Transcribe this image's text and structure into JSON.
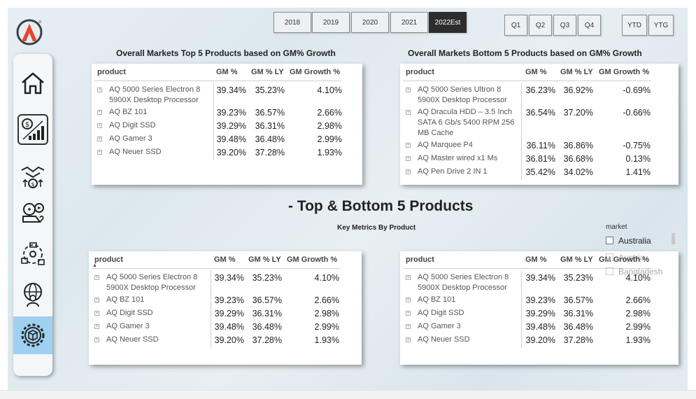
{
  "nav": {
    "items": [
      {
        "icon": "home-icon"
      },
      {
        "icon": "finance-chart-icon"
      },
      {
        "icon": "handshake-money-icon"
      },
      {
        "icon": "marketing-icon"
      },
      {
        "icon": "supply-chain-icon"
      },
      {
        "icon": "global-team-icon"
      },
      {
        "icon": "product-settings-icon"
      }
    ],
    "active_index": 6
  },
  "years": [
    "2018",
    "2019",
    "2020",
    "2021",
    "2022Est"
  ],
  "selected_year": "2022Est",
  "quarters": [
    "Q1",
    "Q2",
    "Q3",
    "Q4"
  ],
  "period_buttons": [
    "YTD",
    "YTG"
  ],
  "top_table": {
    "title": "Overall Markets Top 5 Products based on GM% Growth",
    "headers": {
      "product": "product",
      "gm": "GM %",
      "gm_ly": "GM % LY",
      "growth": "GM Growth %"
    },
    "rows": [
      {
        "product": [
          "AQ 5000 Series Electron 8",
          "5900X Desktop Processor"
        ],
        "gm": "39.34%",
        "gm_ly": "35.23%",
        "growth": "4.10%"
      },
      {
        "product": [
          "AQ BZ 101"
        ],
        "gm": "39.23%",
        "gm_ly": "36.57%",
        "growth": "2.66%"
      },
      {
        "product": [
          "AQ Digit SSD"
        ],
        "gm": "39.29%",
        "gm_ly": "36.31%",
        "growth": "2.98%"
      },
      {
        "product": [
          "AQ Gamer 3"
        ],
        "gm": "39.48%",
        "gm_ly": "36.48%",
        "growth": "2.99%"
      },
      {
        "product": [
          "AQ Neuer SSD"
        ],
        "gm": "39.20%",
        "gm_ly": "37.28%",
        "growth": "1.93%"
      }
    ]
  },
  "bottom_table": {
    "title": "Overall Markets Bottom 5 Products based on GM% Growth",
    "headers": {
      "product": "product",
      "gm": "GM %",
      "gm_ly": "GM % LY",
      "growth": "GM Growth %"
    },
    "rows": [
      {
        "product": [
          "AQ 5000 Series Ultron 8",
          "5900X Desktop Processor"
        ],
        "gm": "36.23%",
        "gm_ly": "36.92%",
        "growth": "-0.69%"
      },
      {
        "product": [
          "AQ Dracula HDD – 3.5 Inch",
          "SATA 6 Gb/s 5400 RPM 256",
          "MB Cache"
        ],
        "gm": "36.54%",
        "gm_ly": "37.20%",
        "growth": "-0.66%"
      },
      {
        "product": [
          "AQ Marquee P4"
        ],
        "gm": "36.11%",
        "gm_ly": "36.86%",
        "growth": "-0.75%"
      },
      {
        "product": [
          "AQ Master wired x1 Ms"
        ],
        "gm": "36.81%",
        "gm_ly": "36.68%",
        "growth": "0.13%"
      },
      {
        "product": [
          "AQ Pen Drive 2 IN 1"
        ],
        "gm": "35.42%",
        "gm_ly": "34.02%",
        "growth": "1.41%"
      }
    ]
  },
  "main_title": "- Top & Bottom 5 Products",
  "sub_title": "Key Metrics By Product",
  "lower_left": {
    "headers": {
      "product": "product",
      "gm": "GM %",
      "gm_ly": "GM % LY",
      "growth": "GM Growth %"
    },
    "rows": [
      {
        "product": [
          "AQ 5000 Series Electron 8",
          "5900X Desktop Processor"
        ],
        "gm": "39.34%",
        "gm_ly": "35.23%",
        "growth": "4.10%"
      },
      {
        "product": [
          "AQ BZ 101"
        ],
        "gm": "39.23%",
        "gm_ly": "36.57%",
        "growth": "2.66%"
      },
      {
        "product": [
          "AQ Digit SSD"
        ],
        "gm": "39.29%",
        "gm_ly": "36.31%",
        "growth": "2.98%"
      },
      {
        "product": [
          "AQ Gamer 3"
        ],
        "gm": "39.48%",
        "gm_ly": "36.48%",
        "growth": "2.99%"
      },
      {
        "product": [
          "AQ Neuer SSD"
        ],
        "gm": "39.20%",
        "gm_ly": "37.28%",
        "growth": "1.93%"
      }
    ]
  },
  "lower_right": {
    "headers": {
      "product": "product",
      "gm": "GM %",
      "gm_ly": "GM % LY",
      "growth": "GM Growth %"
    },
    "rows": [
      {
        "product": [
          "AQ 5000 Series Electron 8",
          "5900X Desktop Processor"
        ],
        "gm": "39.34%",
        "gm_ly": "35.23%",
        "growth": "4.10%"
      },
      {
        "product": [
          "AQ BZ 101"
        ],
        "gm": "39.23%",
        "gm_ly": "36.57%",
        "growth": "2.66%"
      },
      {
        "product": [
          "AQ Digit SSD"
        ],
        "gm": "39.29%",
        "gm_ly": "36.31%",
        "growth": "2.98%"
      },
      {
        "product": [
          "AQ Gamer 3"
        ],
        "gm": "39.48%",
        "gm_ly": "36.48%",
        "growth": "2.99%"
      },
      {
        "product": [
          "AQ Neuer SSD"
        ],
        "gm": "39.20%",
        "gm_ly": "37.28%",
        "growth": "1.93%"
      }
    ]
  },
  "market_slicer": {
    "title": "market",
    "options": [
      "Australia",
      "Austria",
      "Bangladesh"
    ]
  },
  "colors": {
    "accent": "#9fd0f0",
    "selected": "#2d2d2d",
    "logo_red": "#e8432e"
  }
}
